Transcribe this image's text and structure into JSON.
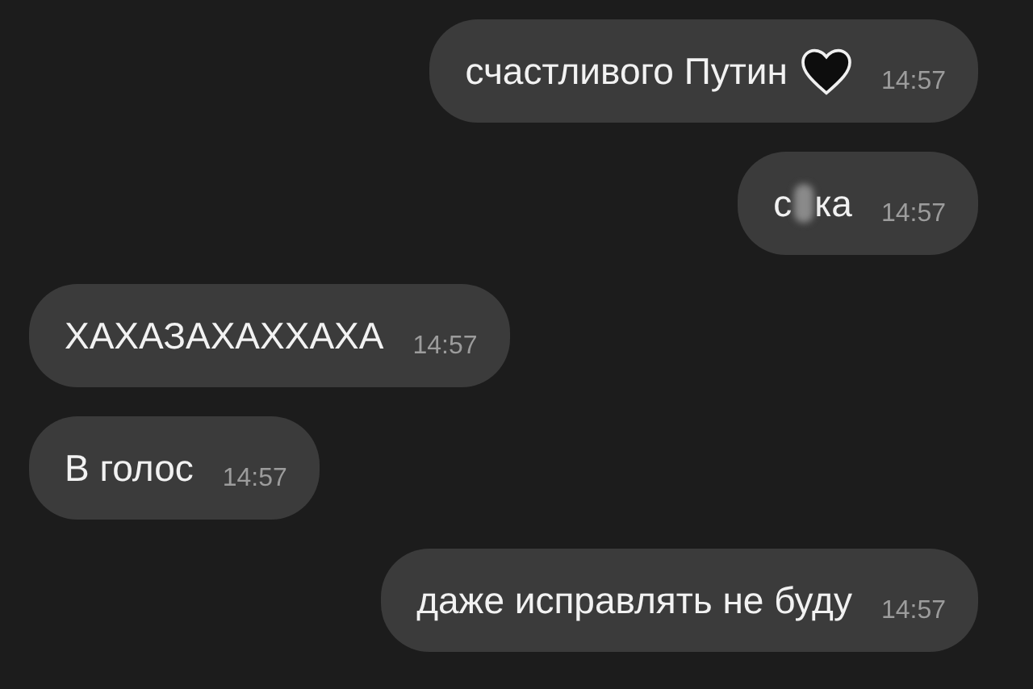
{
  "messages": [
    {
      "sent": true,
      "parts": [
        {
          "kind": "text",
          "text": "счастливого Путин"
        },
        {
          "kind": "heart"
        }
      ],
      "time": "14:57"
    },
    {
      "sent": true,
      "parts": [
        {
          "kind": "text",
          "text": "с"
        },
        {
          "kind": "censored"
        },
        {
          "kind": "text",
          "text": "ка"
        }
      ],
      "time": "14:57"
    },
    {
      "sent": false,
      "parts": [
        {
          "kind": "text",
          "text": "ХАХАЗАХАХХАХА"
        }
      ],
      "time": "14:57"
    },
    {
      "sent": false,
      "parts": [
        {
          "kind": "text",
          "text": "В голос"
        }
      ],
      "time": "14:57"
    },
    {
      "sent": true,
      "parts": [
        {
          "kind": "text",
          "text": "даже исправлять не буду"
        }
      ],
      "time": "14:57"
    }
  ]
}
